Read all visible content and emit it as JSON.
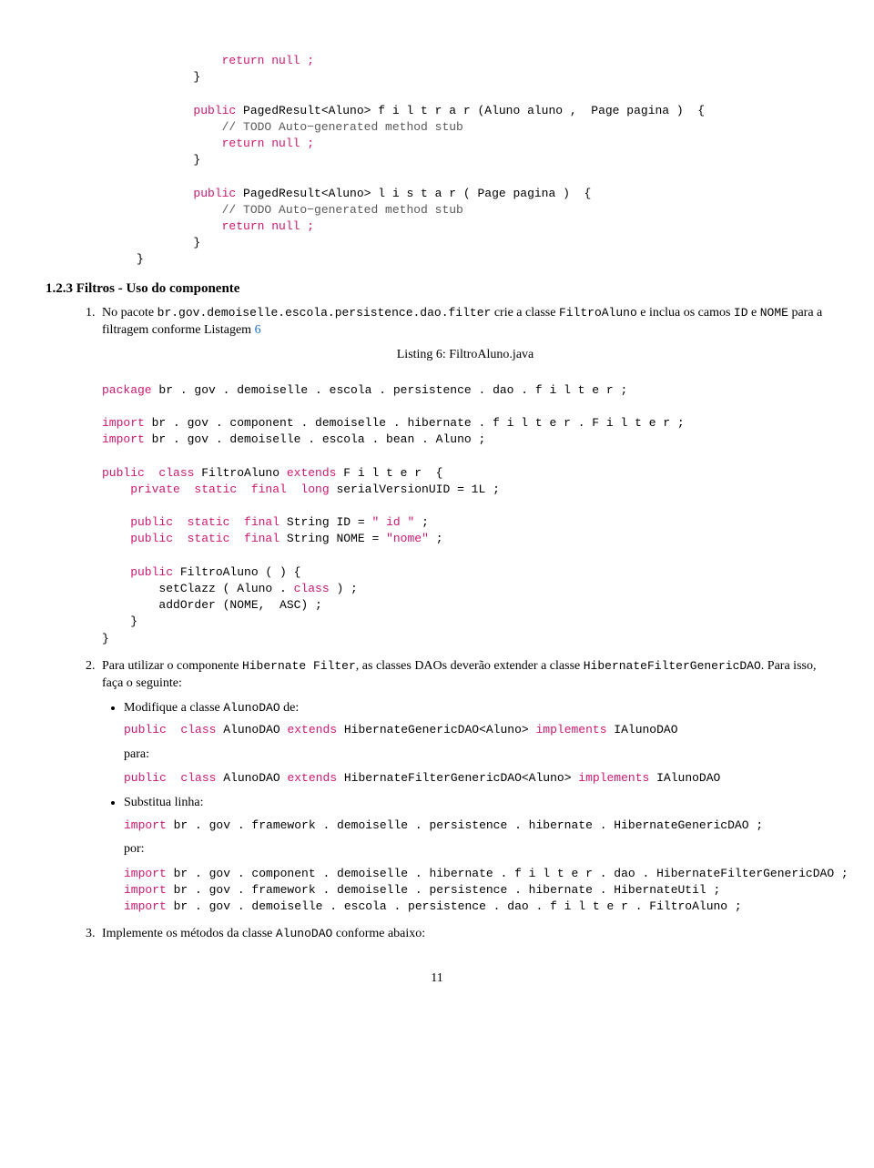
{
  "code1": {
    "l1": "            return null ;",
    "l2": "        }",
    "l3": "        public",
    "l4": " PagedResult<Aluno> f i l t r a r (Aluno aluno ,  Page pagina )  {",
    "l5": "            // TODO Auto−generated method stub",
    "l6": "            return null ;",
    "l7": "        }",
    "l8": "        public",
    "l9": " PagedResult<Aluno> l i s t a r ( Page pagina )  {",
    "l10": "            // TODO Auto−generated method stub",
    "l11": "            return null ;",
    "l12": "        }",
    "l13": "}"
  },
  "heading": "1.2.3   Filtros - Uso do componente",
  "item1": {
    "text_a": "No pacote ",
    "tt_a": "br.gov.demoiselle.escola.persistence.dao.filter",
    "text_b": " crie a classe ",
    "tt_b": "FiltroAluno",
    "text_c": " e inclua os camos ",
    "tt_c": "ID",
    "text_d": " e ",
    "tt_d": "NOME",
    "text_e": " para a filtragem conforme Listagem ",
    "link": "6"
  },
  "listing_caption": "Listing 6: FiltroAluno.java",
  "code2": {
    "l1a": "package",
    "l1b": " br . gov . demoiselle . escola . persistence . dao . f i l t e r ;",
    "l2a": "import",
    "l2b": " br . gov . component . demoiselle . hibernate . f i l t e r . F i l t e r ;",
    "l3a": "import",
    "l3b": " br . gov . demoiselle . escola . bean . Aluno ;",
    "l4a": "public  class",
    "l4b": " FiltroAluno ",
    "l4c": "extends",
    "l4d": " F i l t e r  {",
    "l5a": "    private  static  final  long",
    "l5b": " serialVersionUID = 1L ;",
    "l6a": "    public  static  final",
    "l6b": " String ID = ",
    "l6c": "\" id \"",
    "l6d": " ;",
    "l7a": "    public  static  final",
    "l7b": " String NOME = ",
    "l7c": "\"nome\"",
    "l7d": " ;",
    "l8a": "    public",
    "l8b": " FiltroAluno ( ) {",
    "l9": "        setClazz ( Aluno . ",
    "l9b": "class",
    "l9c": " ) ;",
    "l10": "        addOrder (NOME,  ASC) ;",
    "l11": "    }",
    "l12": "}"
  },
  "item2": {
    "text_a": "Para utilizar o componente ",
    "tt_a": "Hibernate Filter",
    "text_b": ", as classes DAOs deverão extender a classe ",
    "tt_b": "HibernateFilterGenericDAO",
    "text_c": ". Para isso, faça o seguinte:"
  },
  "sub1": {
    "text_a": "Modifique a classe ",
    "tt_a": "AlunoDAO",
    "text_b": " de:",
    "code1a": "public  class",
    "code1b": " AlunoDAO ",
    "code1c": "extends",
    "code1d": " HibernateGenericDAO<Aluno> ",
    "code1e": "implements",
    "code1f": " IAlunoDAO",
    "para": "para:",
    "code2a": "public  class",
    "code2b": " AlunoDAO ",
    "code2c": "extends",
    "code2d": " HibernateFilterGenericDAO<Aluno> ",
    "code2e": "implements",
    "code2f": " IAlunoDAO"
  },
  "sub2": {
    "text": "Substitua linha:",
    "code1a": "import",
    "code1b": " br . gov . framework . demoiselle . persistence . hibernate . HibernateGenericDAO ;",
    "por": "por:",
    "code2a": "import",
    "code2b": " br . gov . component . demoiselle . hibernate . f i l t e r . dao . HibernateFilterGenericDAO ;",
    "code3a": "import",
    "code3b": " br . gov . framework . demoiselle . persistence . hibernate . HibernateUtil ;",
    "code4a": "import",
    "code4b": " br . gov . demoiselle . escola . persistence . dao . f i l t e r . FiltroAluno ;"
  },
  "item3": {
    "text_a": "Implemente os métodos da classe ",
    "tt_a": "AlunoDAO",
    "text_b": " conforme abaixo:"
  },
  "pagenum": "11"
}
